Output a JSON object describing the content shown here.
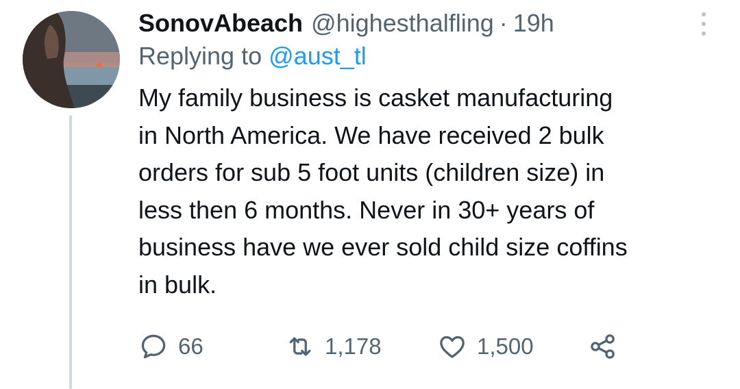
{
  "tweet": {
    "display_name": "SonovAbeach",
    "handle": "@highesthalfling",
    "separator": "·",
    "time": "19h",
    "reply_prefix": "Replying to",
    "reply_to": "@aust_tl",
    "text": "My family business is casket manufacturing\nin North America. We have received 2 bulk\norders for sub 5 foot units (children size) in\nless then 6 months. Never in 30+ years of\nbusiness have we ever sold child size coffins\nin bulk."
  },
  "actions": {
    "reply_count": "66",
    "retweet_count": "1,178",
    "like_count": "1,500"
  },
  "icons": {
    "more": "more-vertical-icon",
    "reply": "reply-icon",
    "retweet": "retweet-icon",
    "like": "heart-icon",
    "share": "share-icon"
  },
  "colors": {
    "text_primary": "#0f1419",
    "text_secondary": "#536471",
    "link": "#1d9bf0",
    "thread_line": "#cfd9de"
  }
}
